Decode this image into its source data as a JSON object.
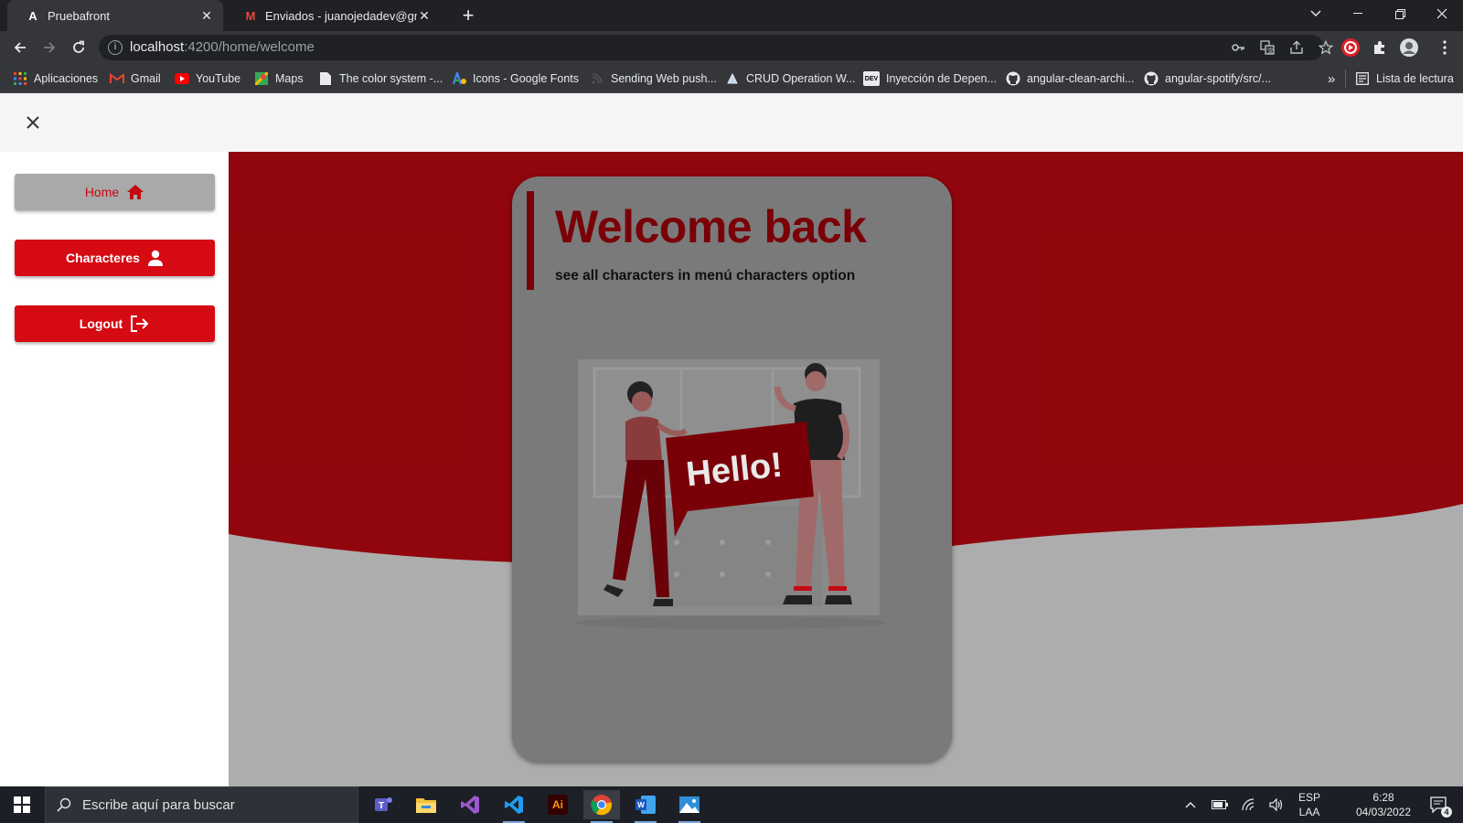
{
  "browser": {
    "tabs": [
      {
        "title": "Pruebafront",
        "favicon_text": "A",
        "active": true
      },
      {
        "title": "Enviados - juanojedadev@gmail.",
        "favicon_text": "M",
        "active": false
      }
    ],
    "url_host": "localhost",
    "url_rest": ":4200/home/welcome",
    "bookmarks": [
      {
        "label": "Aplicaciones",
        "icon": "apps-grid-icon"
      },
      {
        "label": "Gmail",
        "icon": "gmail-icon"
      },
      {
        "label": "YouTube",
        "icon": "youtube-icon"
      },
      {
        "label": "Maps",
        "icon": "maps-icon"
      },
      {
        "label": "The color system -...",
        "icon": "page-icon"
      },
      {
        "label": "Icons - Google Fonts",
        "icon": "google-fonts-icon"
      },
      {
        "label": "Sending Web push...",
        "icon": "rss-icon"
      },
      {
        "label": "CRUD Operation W...",
        "icon": "crud-icon"
      },
      {
        "label": "Inyección de Depen...",
        "icon": "dev-icon"
      },
      {
        "label": "angular-clean-archi...",
        "icon": "github-icon"
      },
      {
        "label": "angular-spotify/src/...",
        "icon": "github-icon"
      }
    ],
    "dev_badge": "DEV",
    "overflow": "»",
    "reading_list": "Lista de lectura"
  },
  "app": {
    "nav": [
      {
        "label": "Home",
        "icon": "home-icon"
      },
      {
        "label": "Characteres",
        "icon": "person-icon"
      },
      {
        "label": "Logout",
        "icon": "logout-icon"
      }
    ],
    "card": {
      "title": "Welcome back",
      "subtitle": "see all characters in menú characters option",
      "illustration_text": "Hello!"
    },
    "colors": {
      "primary": "#d50a12",
      "dark_red": "#7a0008",
      "home_button": "#a9a9a9"
    }
  },
  "taskbar": {
    "search_placeholder": "Escribe aquí para buscar",
    "lang_top": "ESP",
    "lang_bottom": "LAA",
    "time": "6:28",
    "date": "04/03/2022",
    "notifications": "4",
    "adobe_label": "Ai"
  }
}
